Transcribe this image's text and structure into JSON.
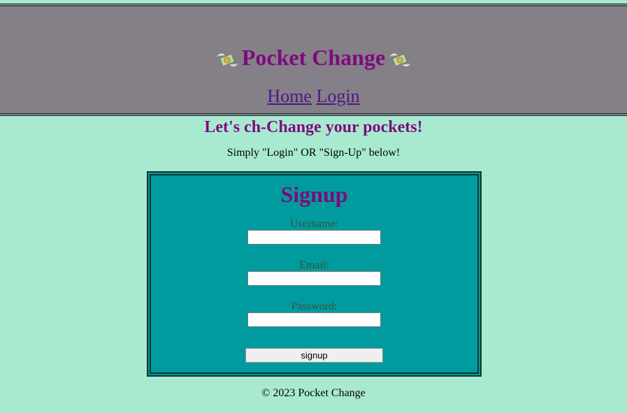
{
  "header": {
    "title": "Pocket Change",
    "icon": "money-with-wings-icon",
    "nav": {
      "home": "Home",
      "login": "Login"
    }
  },
  "intro": {
    "headline": "Let's ch-Change your pockets!",
    "subtext": "Simply \"Login\" OR \"Sign-Up\" below!"
  },
  "signup_form": {
    "title": "Signup",
    "username_label": "Username:",
    "username_value": "",
    "email_label": "Email:",
    "email_value": "",
    "password_label": "Password:",
    "password_value": "",
    "submit_label": "signup"
  },
  "footer": {
    "text": "© 2023 Pocket Change"
  },
  "colors": {
    "page_bg": "#a8ead0",
    "header_bg": "#857f88",
    "card_bg": "#009b9f",
    "title_purple": "#7d0b7d",
    "link_purple": "#4e1684"
  }
}
